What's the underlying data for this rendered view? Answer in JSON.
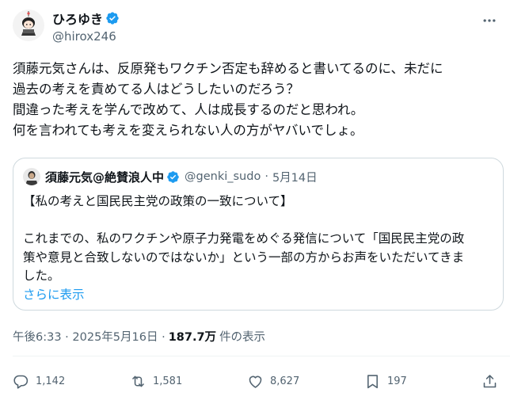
{
  "author": {
    "display_name": "ひろゆき",
    "handle": "@hirox246"
  },
  "tweet": {
    "lines": [
      "須藤元気さんは、反原発もワクチン否定も辞めると書いてるのに、未だに",
      "過去の考えを責めてる人はどうしたいのだろう？",
      "間違った考えを学んで改めて、人は成長するのだと思われ。",
      "何を言われても考えを変えられない人の方がヤバいでしょ。"
    ]
  },
  "quote": {
    "display_name": "須藤元気@絶賛浪人中",
    "handle": "@genki_sudo",
    "separator": "·",
    "date": "5月14日",
    "lines": [
      "【私の考えと国民民主党の政策の一致について】",
      "",
      "これまでの、私のワクチンや原子力発電をめぐる発信について「国民民主党の政",
      "策や意見と合致しないのではないか」という一部の方からお声をいただいてきま",
      "した。"
    ],
    "show_more": "さらに表示"
  },
  "meta": {
    "timestamp": "午後6:33 · 2025年5月16日 ·",
    "views": "187.7万",
    "views_label": "件の表示"
  },
  "actions": {
    "replies": "1,142",
    "reposts": "1,581",
    "likes": "8,627",
    "bookmarks": "197"
  },
  "icons": {
    "verified": "verified-badge-icon",
    "more": "more-dots-icon",
    "reply": "reply-icon",
    "repost": "repost-icon",
    "like": "heart-icon",
    "bookmark": "bookmark-icon",
    "share": "share-icon"
  },
  "colors": {
    "verified_blue": "#1d9bf0",
    "text_primary": "#0f1419",
    "text_secondary": "#536471",
    "border": "#cfd9de",
    "link": "#1d9bf0"
  }
}
